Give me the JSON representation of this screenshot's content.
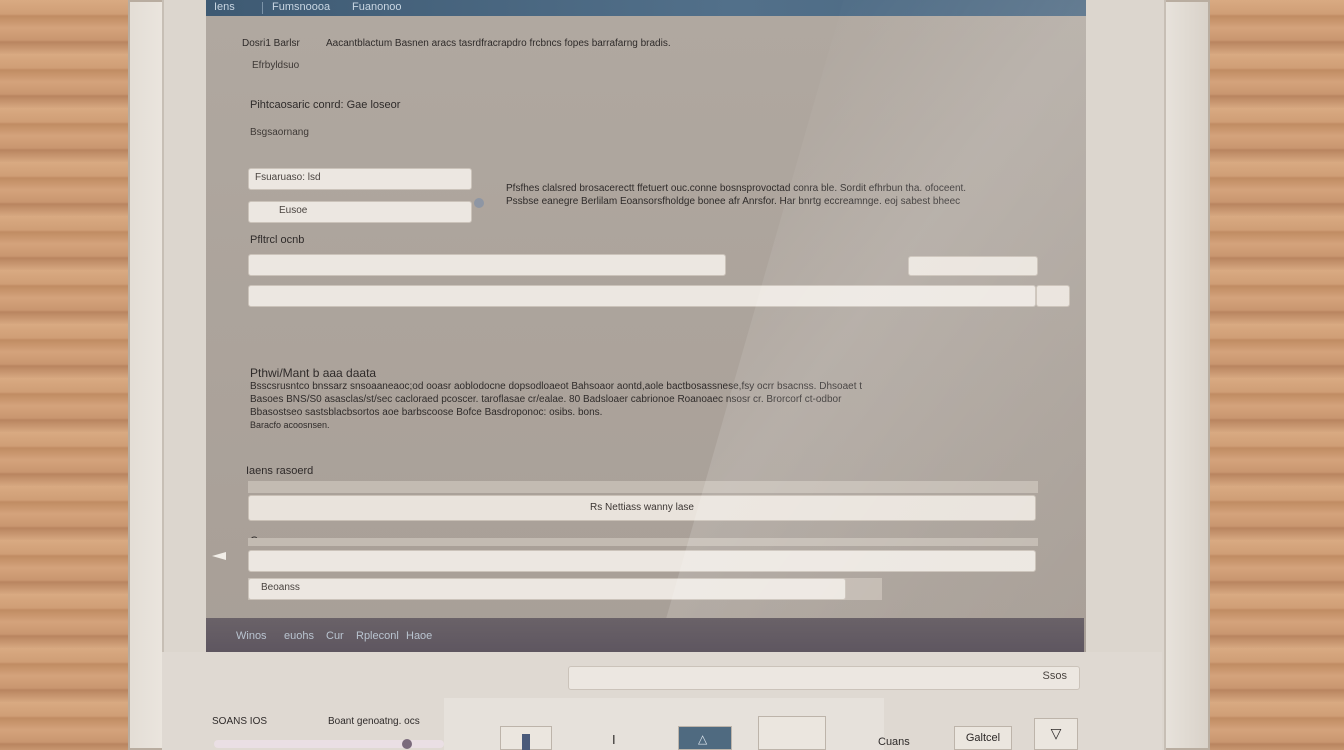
{
  "window": {
    "app_label": "Iens",
    "tab1": "Fumsnoooa",
    "tab2": "Fuanonoo"
  },
  "content": {
    "header_prefix": "Dosri1 Barlsr",
    "header_text": "Aacantblactum Basnen aracs tasrdfracrapdro frcbncs fopes barrafarng bradis.",
    "sublink": "Efrbyldsuo",
    "section1_title": "Pihtcaosaric conrd: Gae loseor",
    "section1_sub": "Bsgsaornang",
    "input1_value": "Fsuaruaso: lsd",
    "input2_value": "Eusoe",
    "desc_line1": "Pfsfhes clalsred brosacerectt ffetuert ouc.conne bosnsprovoctad conra ble. Sordit efhrbun tha. ofoceent.",
    "desc_line2": "Pssbse eanegre Berlilam Eoansorsfholdge bonee afr Anrsfor. Har bnrtg eccreamnge. eoj sabest bheec",
    "field_label": "Pfltrcl ocnb",
    "section2_title": "Pthwi/Mant b aaa daata",
    "para_line1": "Bsscsrusntco bnssarz snsoaaneaoc;od ooasr aoblodocne dopsodloaeot Bahsoaor aontd,aole bactbosassnese,fsy ocrr bsacnss. Dhsoaet t",
    "para_line2": "Basoes BNS/S0 asasclas/st/sec cacloraed pcoscer. taroflasae cr/ealae. 80 Badsloaer cabrionoe Roanoaec nsosr cr. Brorcorf ct-odbor",
    "para_line3": "Bbasostseo sastsblacbsortos aoe barbscoose Bofce Basdroponoc: osibs. bons.",
    "para_line4": "Baracfo acoosnsen.",
    "section3_label": "Iaens rasoerd",
    "wide_button": "Rs Nettiass wanny lase",
    "section4_label": "Csoanacs",
    "progress_label": "Beoanss"
  },
  "statusbar": {
    "item1": "Winos",
    "item2": "euohs",
    "item3": "Cur",
    "item4": "Rpleconl",
    "item5": "Haoe"
  },
  "bottom": {
    "search_value": "Ssos",
    "left_label": "SOANS IOS",
    "left_label2": "Boant genoatng. ocs",
    "btn_cursor": "I",
    "btn_cancel": "Cuans",
    "btn_confirm": "Galtcel",
    "progress_fraction": 0.6
  },
  "colors": {
    "titlebar": "#4b6780",
    "screen": "#aca39b",
    "statusbar": "#625a62",
    "field": "#ece7e1"
  }
}
